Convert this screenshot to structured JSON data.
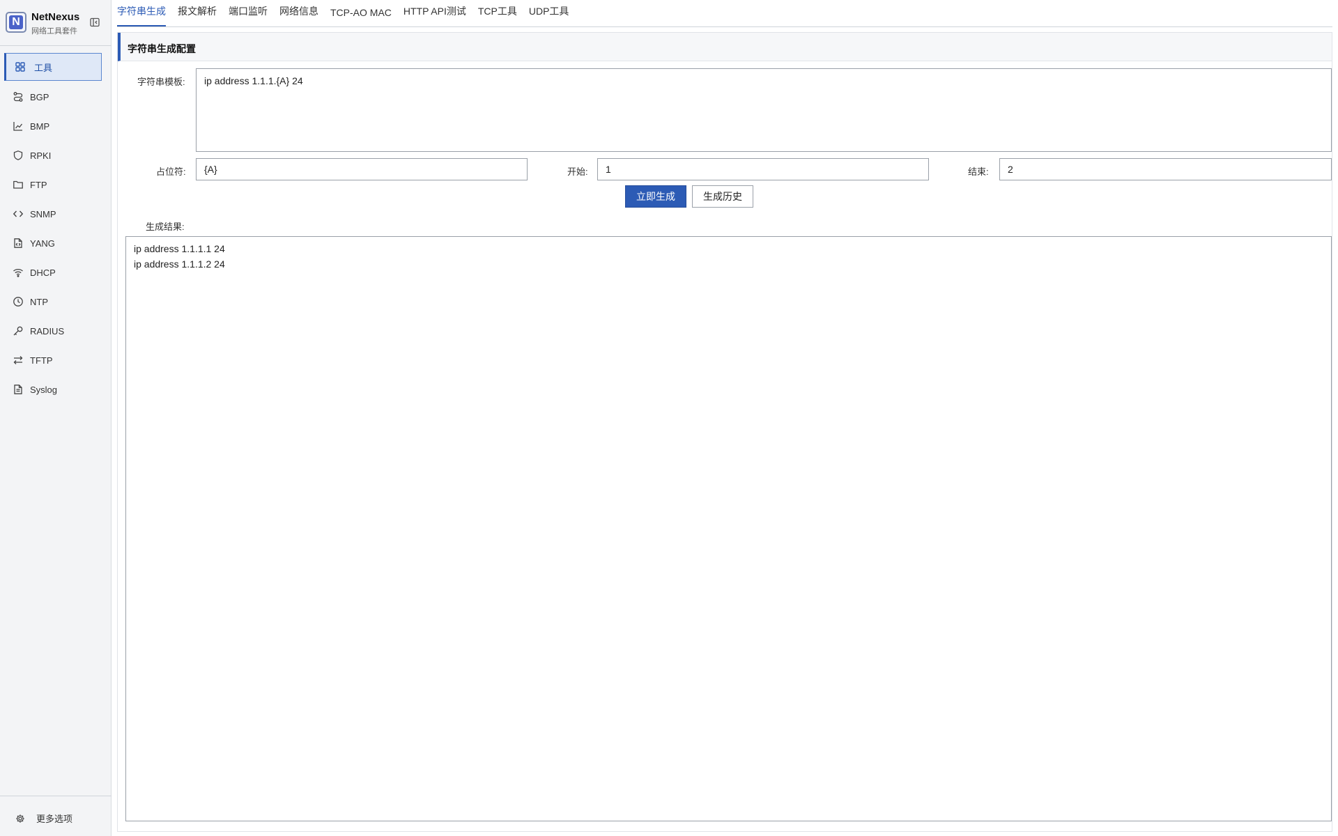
{
  "brand": {
    "name": "NetNexus",
    "subtitle": "网络工具套件",
    "logo_letter": "N"
  },
  "sidebar": {
    "items": [
      {
        "label": "工具",
        "icon": "grid-icon",
        "active": true
      },
      {
        "label": "BGP",
        "icon": "route-icon"
      },
      {
        "label": "BMP",
        "icon": "chart-icon"
      },
      {
        "label": "RPKI",
        "icon": "shield-icon"
      },
      {
        "label": "FTP",
        "icon": "folder-icon"
      },
      {
        "label": "SNMP",
        "icon": "code-icon"
      },
      {
        "label": "YANG",
        "icon": "file-code-icon"
      },
      {
        "label": "DHCP",
        "icon": "wifi-icon"
      },
      {
        "label": "NTP",
        "icon": "clock-icon"
      },
      {
        "label": "RADIUS",
        "icon": "key-icon"
      },
      {
        "label": "TFTP",
        "icon": "transfer-icon"
      },
      {
        "label": "Syslog",
        "icon": "document-icon"
      }
    ],
    "more_options": "更多选项"
  },
  "tabs": [
    {
      "label": "字符串生成",
      "active": true
    },
    {
      "label": "报文解析"
    },
    {
      "label": "端口监听"
    },
    {
      "label": "网络信息"
    },
    {
      "label": "TCP-AO MAC"
    },
    {
      "label": "HTTP API测试"
    },
    {
      "label": "TCP工具"
    },
    {
      "label": "UDP工具"
    }
  ],
  "panel": {
    "title": "字符串生成配置",
    "template_label": "字符串模板:",
    "template_value": "ip address 1.1.1.{A} 24",
    "placeholder_label": "占位符:",
    "placeholder_value": "{A}",
    "start_label": "开始:",
    "start_value": "1",
    "end_label": "结束:",
    "end_value": "2",
    "generate_button": "立即生成",
    "history_button": "生成历史",
    "result_label": "生成结果:",
    "result_lines": [
      "ip address 1.1.1.1 24",
      "ip address 1.1.1.2 24"
    ]
  },
  "colors": {
    "accent": "#2c5bb5",
    "sidebar_bg": "#f3f4f6",
    "active_item_bg": "#dfe8f7"
  }
}
